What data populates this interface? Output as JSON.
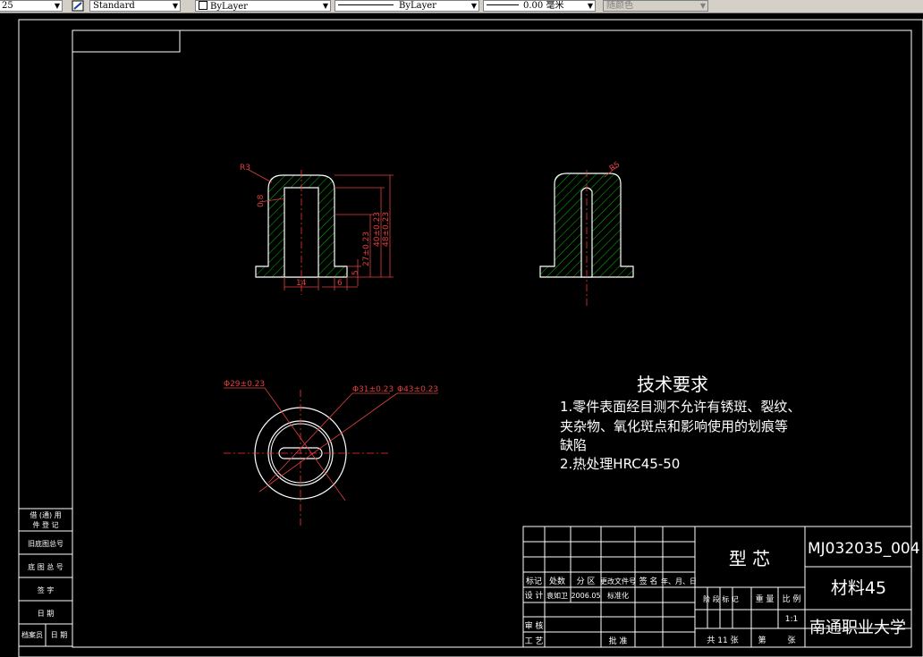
{
  "toolbar": {
    "scale_value": "25",
    "text_style": "Standard",
    "layer": "ByLayer",
    "linetype": "ByLayer",
    "lineweight": "0.00",
    "lineweight_unit": "毫米",
    "plot_color": "随颜色"
  },
  "drawing": {
    "dims_front": [
      "R3",
      "0.8",
      "14",
      "6",
      "5",
      "27±0.23",
      "40±0.23",
      "48±0.23"
    ],
    "dim_side": "R5",
    "dims_top": [
      "Φ29±0.23",
      "Φ31±0.23",
      "Φ43±0.23"
    ],
    "tech_req": {
      "heading": "技术要求",
      "line1": "1.零件表面经目测不允许有锈斑、裂纹、",
      "line2": "夹杂物、氧化斑点和影响使用的划痕等",
      "line3": "缺陷",
      "line4": "2.热处理HRC45-50"
    },
    "side_table": [
      "借 (通) 用",
      "件 登 记",
      "旧底图总号",
      "底 图 总 号",
      "签    字",
      "日    期",
      "档案员",
      "日 期"
    ],
    "title_block": {
      "part_name": "型 芯",
      "drawing_no": "MJ032035_004",
      "material": "材料45",
      "school": "南通职业大学",
      "headers": [
        "标记",
        "处数",
        "分 区",
        "更改文件号",
        "签 名",
        "年、月、日"
      ],
      "design_label": "设 计",
      "designer": "袁如卫",
      "design_date": "2006.05",
      "standardize": "标准化",
      "review": "审 核",
      "process": "工 艺",
      "approve": "批 准",
      "stage_label": "阶 段 标 记",
      "weight_label": "重 量",
      "scale_label": "比 例",
      "scale": "1:1",
      "sheets_total": "共 11 张",
      "sheet_no": "第",
      "sheet_label": "张"
    }
  }
}
